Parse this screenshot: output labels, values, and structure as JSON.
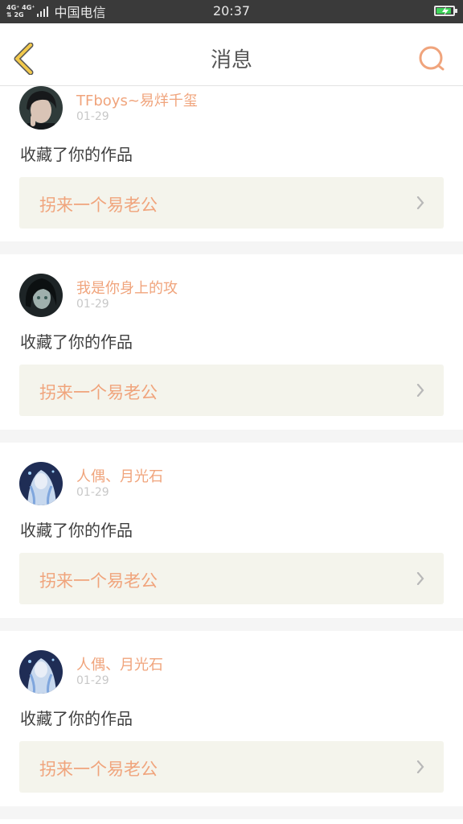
{
  "status_bar": {
    "net_top": "4G⁺ 4G⁺",
    "net_bottom": "⇅  2G",
    "carrier": "中国电信",
    "time": "20:37"
  },
  "header": {
    "title": "消息",
    "accent_color": "#f0a47c",
    "back_icon_color": "#f2c94c"
  },
  "messages": [
    {
      "user": "TFboys~易烊千玺",
      "date": "01-29",
      "action": "收藏了你的作品",
      "work_title": "拐来一个易老公",
      "avatar": "avatar-portrait-dark"
    },
    {
      "user": "我是你身上的攻",
      "date": "01-29",
      "action": "收藏了你的作品",
      "work_title": "拐来一个易老公",
      "avatar": "avatar-anime-dark"
    },
    {
      "user": "人偶、月光石",
      "date": "01-29",
      "action": "收藏了你的作品",
      "work_title": "拐来一个易老公",
      "avatar": "avatar-anime-blue"
    },
    {
      "user": "人偶、月光石",
      "date": "01-29",
      "action": "收藏了你的作品",
      "work_title": "拐来一个易老公",
      "avatar": "avatar-anime-blue"
    }
  ]
}
